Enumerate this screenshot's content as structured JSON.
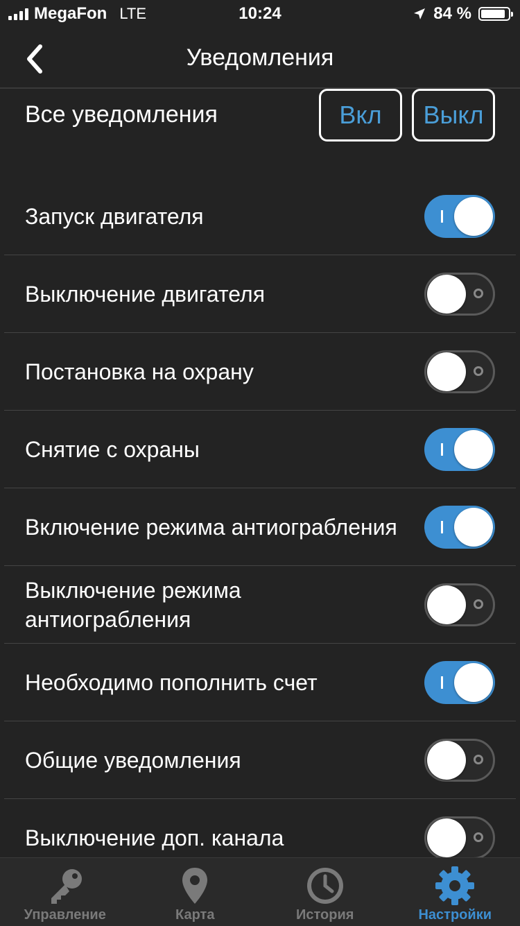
{
  "status_bar": {
    "carrier": "MegaFon",
    "network": "LTE",
    "time": "10:24",
    "battery": "84 %"
  },
  "header": {
    "title": "Уведомления"
  },
  "all_notifications": {
    "label": "Все уведомления",
    "on_label": "Вкл",
    "off_label": "Выкл"
  },
  "items": [
    {
      "label": "Запуск двигателя",
      "enabled": true
    },
    {
      "label": "Выключение двигателя",
      "enabled": false
    },
    {
      "label": "Постановка на охрану",
      "enabled": false
    },
    {
      "label": "Снятие с охраны",
      "enabled": true
    },
    {
      "label": "Включение режима антиограбления",
      "enabled": true
    },
    {
      "label": "Выключение режима антиограбления",
      "enabled": false
    },
    {
      "label": "Необходимо пополнить счет",
      "enabled": true
    },
    {
      "label": "Общие уведомления",
      "enabled": false
    },
    {
      "label": "Выключение доп. канала",
      "enabled": false
    }
  ],
  "tabs": [
    {
      "label": "Управление",
      "icon": "key-icon",
      "active": false
    },
    {
      "label": "Карта",
      "icon": "map-pin-icon",
      "active": false
    },
    {
      "label": "История",
      "icon": "clock-icon",
      "active": false
    },
    {
      "label": "Настройки",
      "icon": "gear-icon",
      "active": true
    }
  ],
  "colors": {
    "accent": "#3d8fd2",
    "background": "#232323",
    "inactive": "#7a7a7a"
  }
}
